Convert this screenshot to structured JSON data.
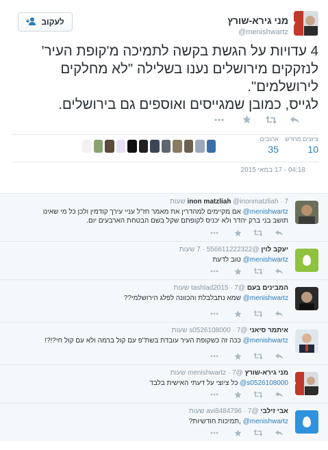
{
  "tweet": {
    "fullname": "מני גירא-שורץ",
    "username": "@menishwartz",
    "follow_label": "לעקוב",
    "text_lines": [
      "4 עדויות על הגשת בקשה לתמיכה מ'קופת העיר'",
      "לנזקקים מירושלים נענו בשלילה \"לא מחלקים",
      "לירושלמים\".",
      "לגייס, כמובן שמגייסים ואוספים גם בירושלים."
    ],
    "stats": {
      "retweets_label": "ציוצים מחדש",
      "retweets_value": "10",
      "likes_label": "אהובים",
      "likes_value": "35"
    },
    "timestamp": "04:18 - 17 במאי 2015",
    "likers_colors": [
      "#f2f2f2",
      "#8aa26f",
      "#5a4a3a",
      "#e8e0f5",
      "#111111",
      "#202020",
      "#3b4652",
      "#5e6670",
      "#8a7a62",
      "#6c6050",
      "#9aa8b8",
      "#3a6ea5"
    ]
  },
  "icons": {
    "reply": "reply-icon",
    "retweet": "retweet-icon",
    "like": "star-icon",
    "more": "more-icon",
    "follow": "add-user-icon"
  },
  "replies": [
    {
      "name": "inon matzliah",
      "username": "@inonmatzliah",
      "time": "7 שעות",
      "lines": [
        "@menishwartz אם מקיימים למהדרין את מאמר חז\"ל עניי עירך קודמין ולכן כל מי שאינו",
        "תושב בני ברק יהדר ולא יכניס לקופתם שקל בשם הבטחת הארבעים יום."
      ],
      "avatar": "photo"
    },
    {
      "name": "יעקב לוין",
      "username": "@556611222322",
      "time": "7 שעות",
      "lines": [
        "@menishwartz טוב לדעת"
      ],
      "avatar": "egg-yellow"
    },
    {
      "name": "המבינים בעם",
      "username": "@tashlad2015",
      "time": "7 שעות",
      "lines": [
        "@menishwartz שמא נתבלבלת והכוונה לפלג הירושלמי??"
      ],
      "avatar": "photo-dark"
    },
    {
      "name": "איתמר סיאני",
      "username": "@s0526108000",
      "time": "7 שעות",
      "lines": [
        "@menishwartz ככה זה כשקופת העיר עובדת בשת\"פ עם קול ברמה ולא עם קול חי?!?!"
      ],
      "avatar": "photo-suit"
    },
    {
      "name": "מני גירא-שורץ",
      "username": "@menishwartz",
      "time": "7 שעות",
      "lines": [
        "@s0526108000 כל ציוצי על דעתי האישית בלבד"
      ],
      "avatar": "photo-logo"
    },
    {
      "name": "אבי זילבי",
      "username": "@avi8484796",
      "time": "7 שעות",
      "lines": [
        "@menishwartz ,תמיכות חודשיות?"
      ],
      "avatar": "egg-blue"
    }
  ]
}
